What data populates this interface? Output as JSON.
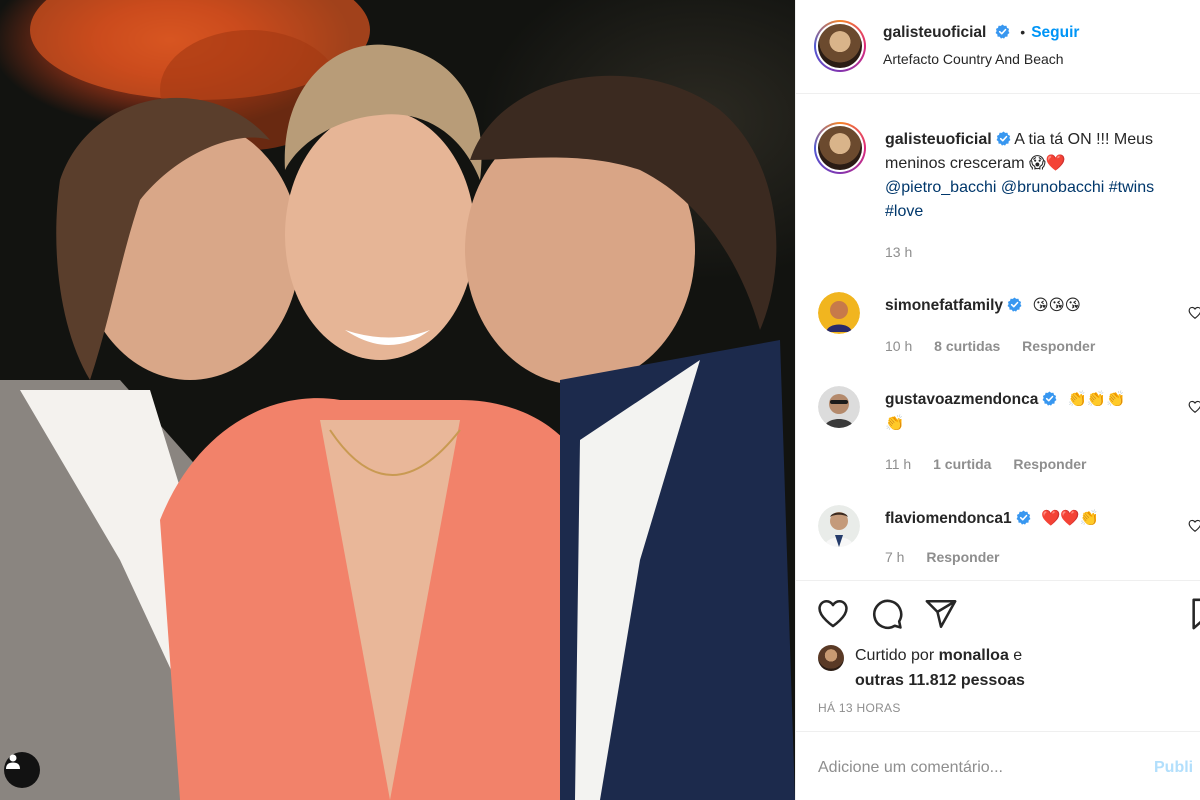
{
  "post_header": {
    "username": "galisteuoficial",
    "follow_label": "Seguir",
    "separator": "•",
    "location": "Artefacto Country And Beach"
  },
  "caption": {
    "username": "galisteuoficial",
    "line1_text": "A tia tá ON !!! Meus",
    "line2_text": "meninos cresceram 😱❤️",
    "mention1": "@pietro_bacchi",
    "mention2": "@brunobacchi",
    "hashtag1": "#twins",
    "hashtag2": "#love",
    "time": "13 h"
  },
  "comments": [
    {
      "username": "simonefatfamily",
      "text": "😘😘😘",
      "time": "10 h",
      "likes": "8 curtidas",
      "reply": "Responder"
    },
    {
      "username": "gustavoazmendonca",
      "text": "👏👏👏",
      "text2": "👏",
      "time": "11 h",
      "likes": "1 curtida",
      "reply": "Responder"
    },
    {
      "username": "flaviomendonca1",
      "text": "❤️❤️👏",
      "time": "7 h",
      "reply": "Responder"
    }
  ],
  "likes": {
    "prefix": "Curtido por",
    "user": "monalloa",
    "connector": "e",
    "others": "outras 11.812 pessoas"
  },
  "time_ago": "HÁ 13 HORAS",
  "comment_input": {
    "placeholder": "Adicione um comentário...",
    "publish_label": "Publi"
  },
  "colors": {
    "accent_blue": "#0095f6",
    "link_blue": "#00376b",
    "verified_blue": "#3897f0",
    "muted_gray": "#8e8e8e",
    "border": "#efefef"
  },
  "icons": [
    "verified-badge-icon",
    "heart-icon",
    "comment-icon",
    "share-icon",
    "bookmark-icon",
    "user-tag-icon"
  ]
}
